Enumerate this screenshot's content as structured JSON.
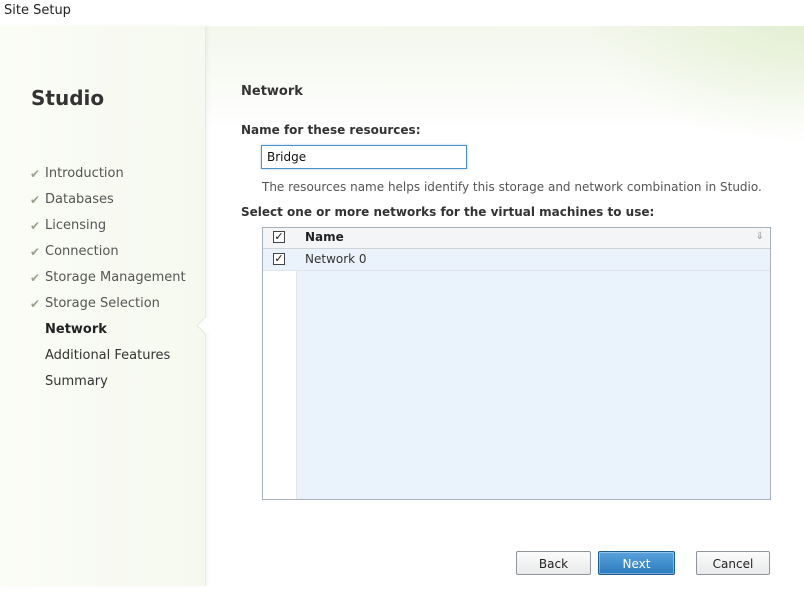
{
  "window": {
    "title": "Site Setup"
  },
  "sidebar": {
    "title": "Studio",
    "steps": [
      {
        "label": "Introduction",
        "state": "done"
      },
      {
        "label": "Databases",
        "state": "done"
      },
      {
        "label": "Licensing",
        "state": "done"
      },
      {
        "label": "Connection",
        "state": "done"
      },
      {
        "label": "Storage Management",
        "state": "done"
      },
      {
        "label": "Storage Selection",
        "state": "done"
      },
      {
        "label": "Network",
        "state": "active"
      },
      {
        "label": "Additional Features",
        "state": "pending"
      },
      {
        "label": "Summary",
        "state": "pending"
      }
    ],
    "check_icon": "checkmark-icon"
  },
  "main": {
    "title": "Network",
    "name_label": "Name for these resources:",
    "name_value": "Bridge",
    "hint": "The resources name helps identify this storage and network combination in Studio.",
    "select_label": "Select one or more networks for the virtual machines to use:",
    "grid": {
      "header_checked": true,
      "column_name": "Name",
      "rows": [
        {
          "name": "Network 0",
          "checked": true
        }
      ]
    }
  },
  "buttons": {
    "back": "Back",
    "next": "Next",
    "cancel": "Cancel"
  },
  "colors": {
    "accent": "#2b7bbd",
    "selection": "#eaf3fb"
  }
}
